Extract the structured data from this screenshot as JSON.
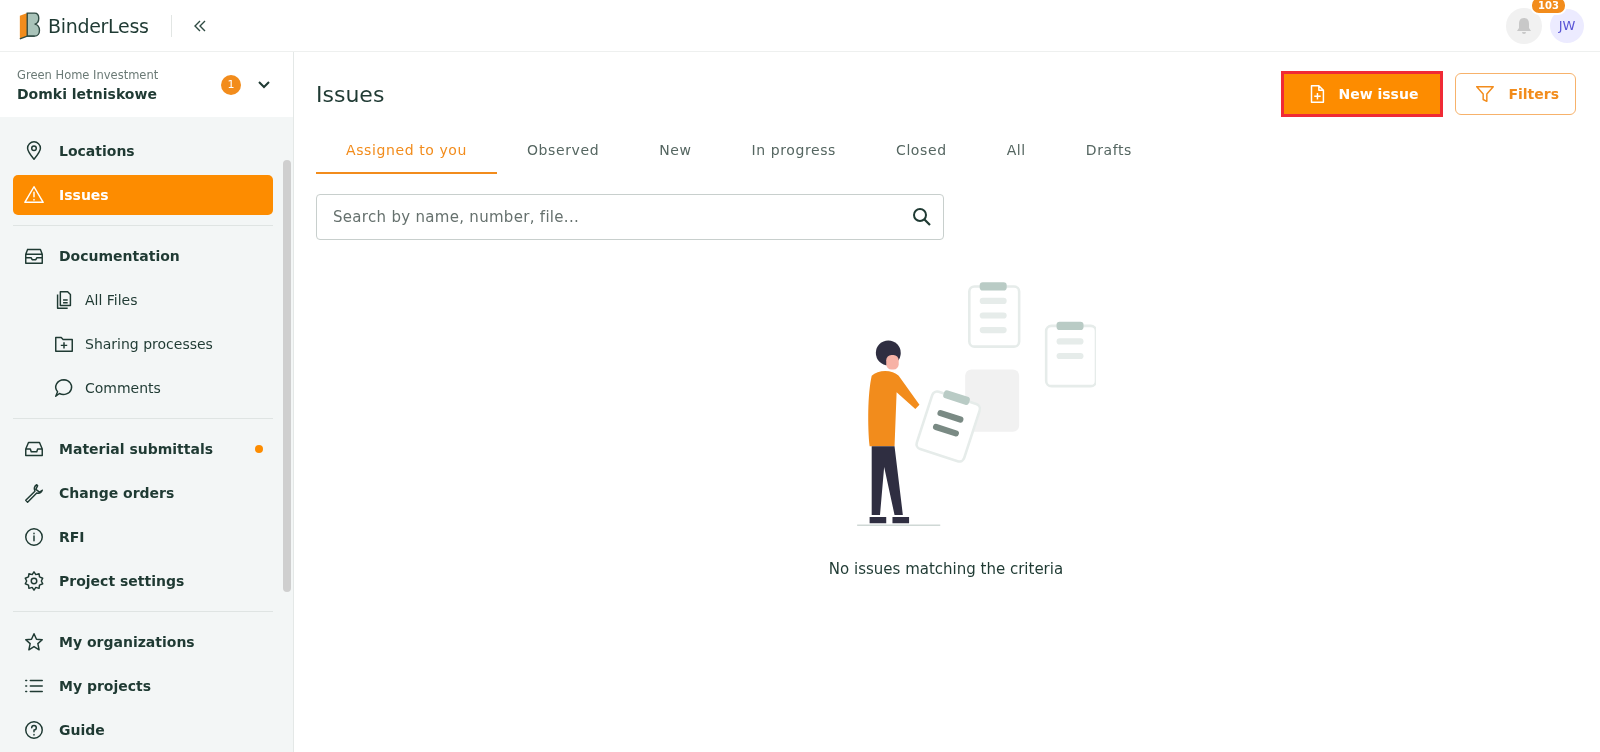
{
  "header": {
    "logo_text": "BinderLess",
    "notifications_badge": "103",
    "avatar_initials": "JW"
  },
  "project": {
    "organization": "Green Home Investment",
    "name": "Domki letniskowe",
    "badge": "1"
  },
  "sidebar": {
    "groups": [
      {
        "items": [
          {
            "label": "Locations",
            "selected": false,
            "dot": false
          },
          {
            "label": "Issues",
            "selected": true,
            "dot": false
          }
        ]
      },
      {
        "items": [
          {
            "label": "Documentation",
            "selected": false,
            "dot": false,
            "children": [
              {
                "label": "All Files",
                "selected": false
              },
              {
                "label": "Sharing processes",
                "selected": false
              },
              {
                "label": "Comments",
                "selected": false
              }
            ]
          }
        ]
      },
      {
        "items": [
          {
            "label": "Material submittals",
            "selected": false,
            "dot": true
          },
          {
            "label": "Change orders",
            "selected": false,
            "dot": false
          },
          {
            "label": "RFI",
            "selected": false,
            "dot": false
          },
          {
            "label": "Project settings",
            "selected": false,
            "dot": false
          }
        ]
      },
      {
        "items": [
          {
            "label": "My organizations",
            "selected": false,
            "dot": false
          },
          {
            "label": "My projects",
            "selected": false,
            "dot": false
          },
          {
            "label": "Guide",
            "selected": false,
            "dot": false
          }
        ]
      }
    ]
  },
  "page": {
    "title": "Issues",
    "new_button": {
      "label": "New issue",
      "highlighted": true
    },
    "filters_button": "Filters",
    "tabs": [
      {
        "label": "Assigned to you",
        "selected": true
      },
      {
        "label": "Observed",
        "selected": false
      },
      {
        "label": "New",
        "selected": false
      },
      {
        "label": "In progress",
        "selected": false
      },
      {
        "label": "Closed",
        "selected": false
      },
      {
        "label": "All",
        "selected": false
      },
      {
        "label": "Drafts",
        "selected": false
      }
    ],
    "search": {
      "placeholder": "Search by name, number, file..."
    },
    "empty_message": "No issues matching the criteria"
  }
}
